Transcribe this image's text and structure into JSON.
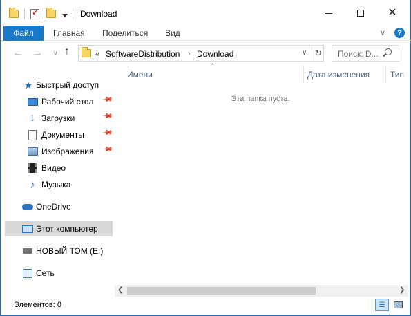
{
  "window": {
    "title": "Download"
  },
  "ribbon": {
    "tabs": [
      "Файл",
      "Главная",
      "Поделиться",
      "Вид"
    ],
    "help": "?"
  },
  "nav": {
    "path": [
      "«",
      "SoftwareDistribution",
      "Download"
    ],
    "search_placeholder": "Поиск: D...",
    "refresh_glyph": "↻"
  },
  "navpane": {
    "items": [
      {
        "label": "Быстрый доступ",
        "icon": "star-icon"
      },
      {
        "label": "Рабочий стол",
        "icon": "desktop-icon",
        "pinned": true
      },
      {
        "label": "Загрузки",
        "icon": "downloads-icon",
        "pinned": true
      },
      {
        "label": "Документы",
        "icon": "documents-icon",
        "pinned": true
      },
      {
        "label": "Изображения",
        "icon": "pictures-icon",
        "pinned": true
      },
      {
        "label": "Видео",
        "icon": "videos-icon"
      },
      {
        "label": "Музыка",
        "icon": "music-icon"
      },
      {
        "label": "OneDrive",
        "icon": "onedrive-icon"
      },
      {
        "label": "Этот компьютер",
        "icon": "this-pc-icon",
        "selected": true
      },
      {
        "label": "НОВЫЙ ТОМ (E:)",
        "icon": "drive-icon"
      },
      {
        "label": "Сеть",
        "icon": "network-icon"
      }
    ]
  },
  "content": {
    "columns": [
      "Имени",
      "Дата изменения",
      "Тип"
    ],
    "empty_text": "Эта папка пуста."
  },
  "status": {
    "text": "Элементов: 0"
  }
}
